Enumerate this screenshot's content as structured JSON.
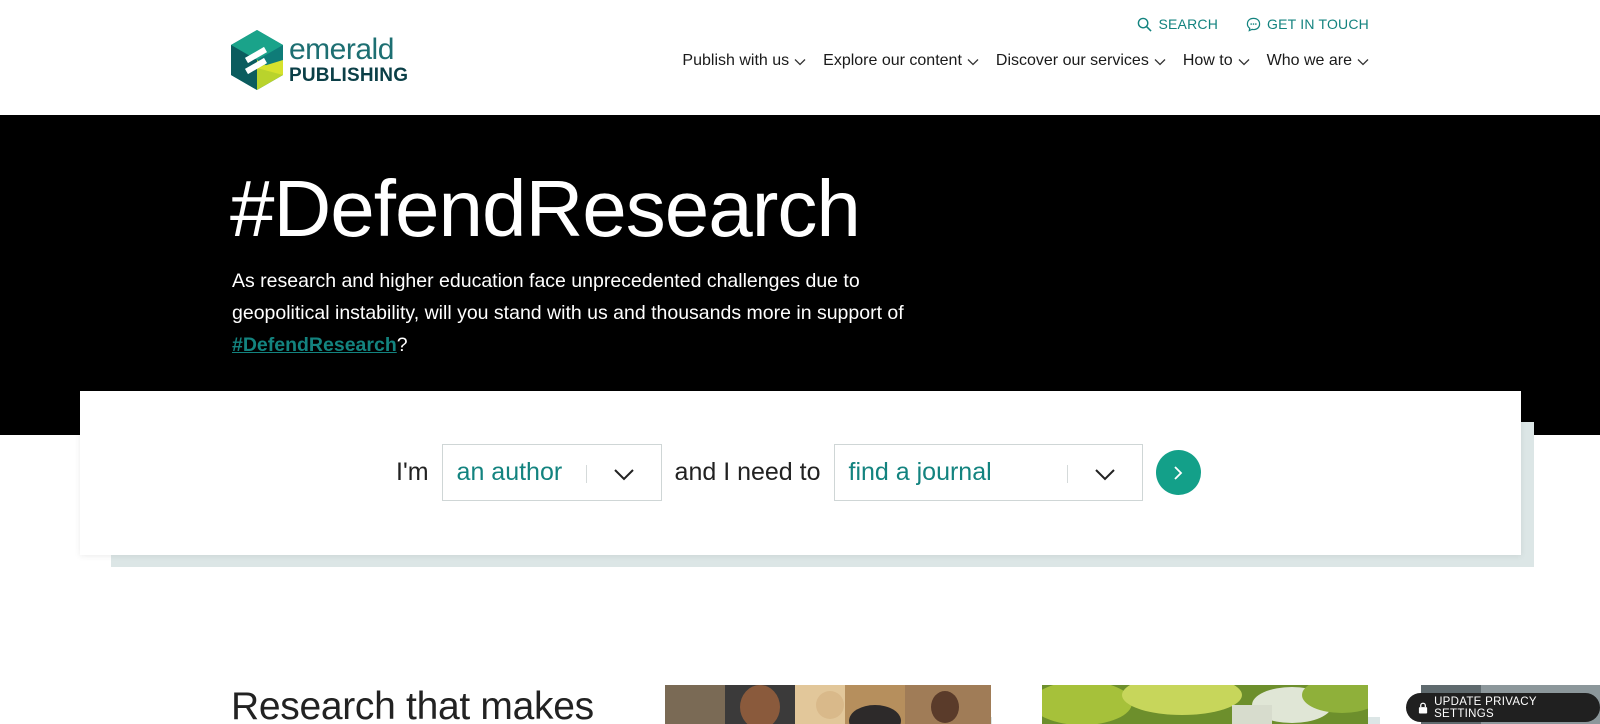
{
  "header": {
    "logo": {
      "word1": "emerald",
      "word2": "PUBLISHING"
    },
    "utility": {
      "search_label": "SEARCH",
      "contact_label": "GET IN TOUCH"
    },
    "nav": [
      {
        "label": "Publish with us"
      },
      {
        "label": "Explore our content"
      },
      {
        "label": "Discover our services"
      },
      {
        "label": "How to"
      },
      {
        "label": "Who we are"
      }
    ]
  },
  "hero": {
    "title": "#DefendResearch",
    "text_before": "As research and higher education face unprecedented challenges due to geopolitical instability, will you stand with us and thousands more in support of ",
    "link_text": "#DefendResearch",
    "text_after": "?"
  },
  "selector": {
    "prefix": "I'm",
    "role_value": "an author",
    "middle": "and I need to",
    "task_value": "find a journal"
  },
  "bottom": {
    "heading": "Research that makes"
  },
  "privacy": {
    "label": "UPDATE PRIVACY SETTINGS"
  },
  "colors": {
    "accent": "#13837f",
    "button": "#13a089",
    "hero_bg": "#000000",
    "card_shadow": "#dce6e6"
  }
}
